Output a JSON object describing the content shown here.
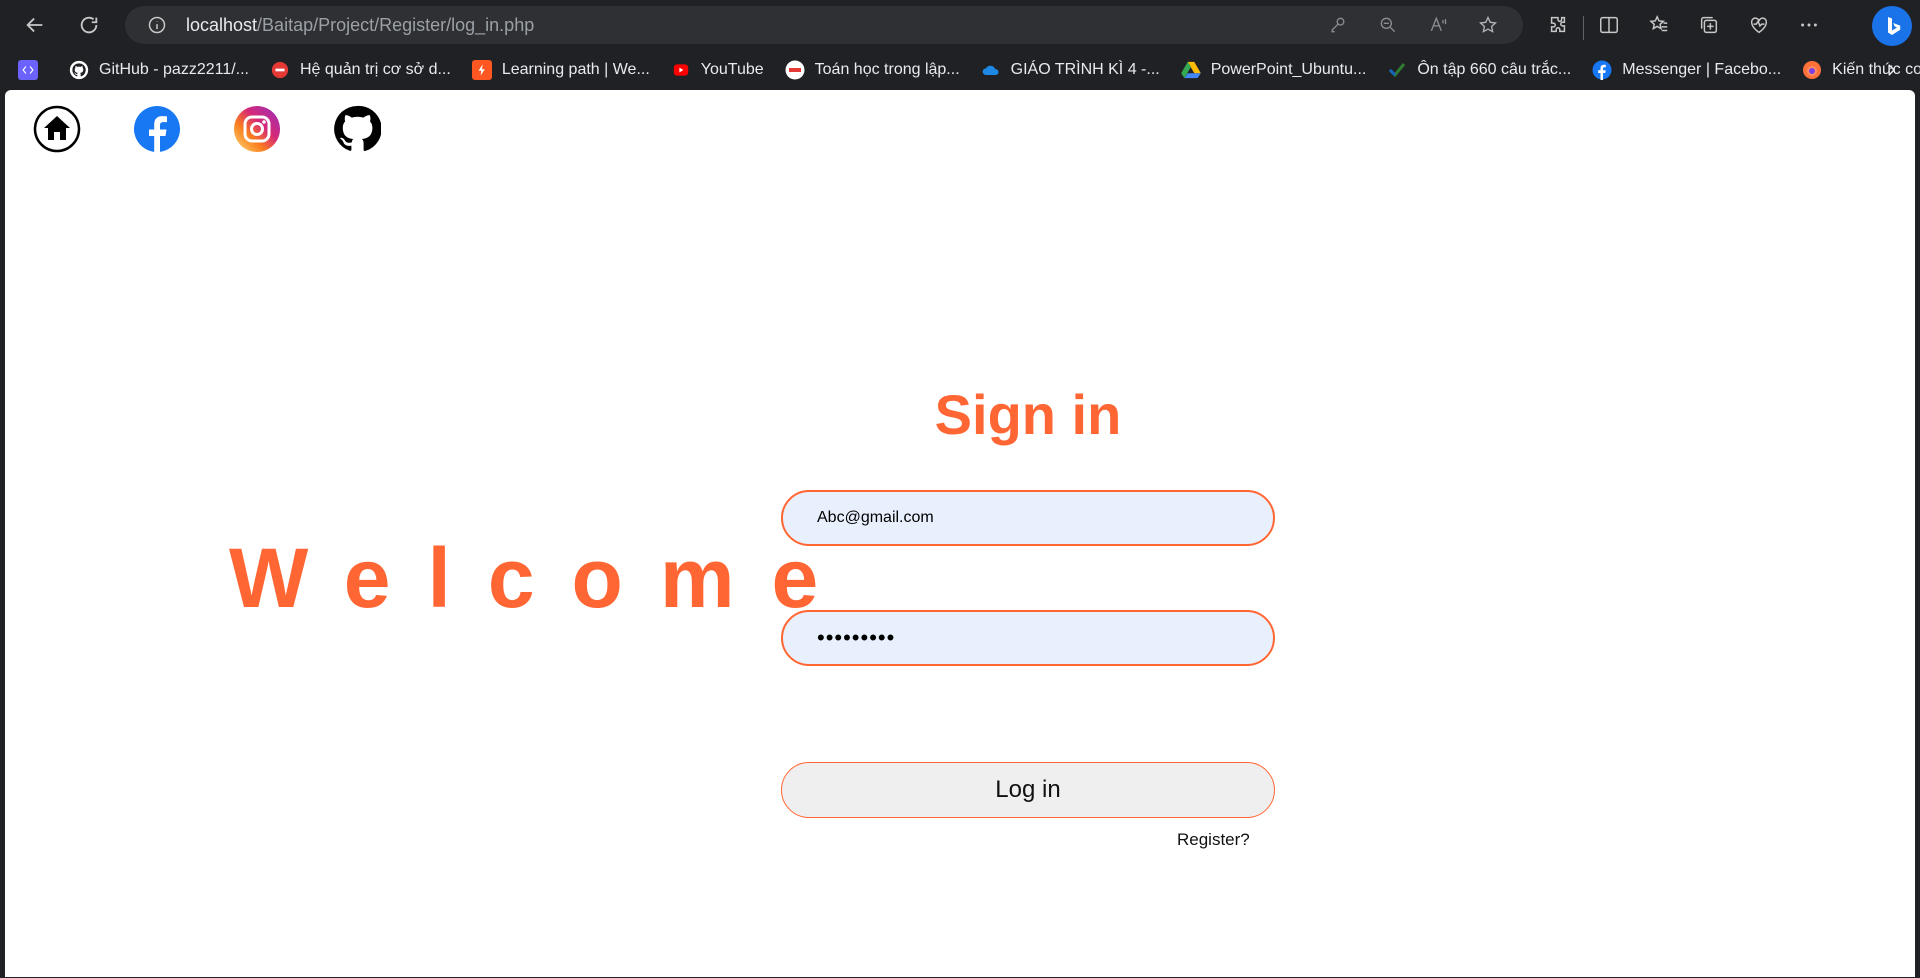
{
  "browser": {
    "url_host": "localhost",
    "url_path": "/Baitap/Project/Register/log_in.php",
    "icons": [
      "back-arrow-icon",
      "refresh-icon",
      "info-icon",
      "key-icon",
      "zoom-out-icon",
      "read-aloud-icon",
      "favorite-star-icon",
      "extensions-icon",
      "split-screen-icon",
      "favorites-icon",
      "collections-icon",
      "browser-essentials-icon",
      "more-icon",
      "copilot-icon"
    ]
  },
  "bookmarks": [
    {
      "label": "",
      "icon": "app-icon",
      "color": "#6c63ff"
    },
    {
      "label": "GitHub - pazz2211/...",
      "icon": "github-icon",
      "color": "#ffffff"
    },
    {
      "label": "Hệ quản trị cơ sở d...",
      "icon": "db-icon",
      "color": "#e53935"
    },
    {
      "label": "Learning path | We...",
      "icon": "learning-icon",
      "color": "#ff5722"
    },
    {
      "label": "YouTube",
      "icon": "youtube-icon",
      "color": "#ff0000"
    },
    {
      "label": "Toán học trong lập...",
      "icon": "math-icon",
      "color": "#ffffff"
    },
    {
      "label": "GIÁO TRÌNH KÌ 4 -...",
      "icon": "onedrive-icon",
      "color": "#1e88e5"
    },
    {
      "label": "PowerPoint_Ubuntu...",
      "icon": "drive-icon",
      "color": "#34a853"
    },
    {
      "label": "Ôn tập 660 câu trắc...",
      "icon": "check-icon",
      "color": "#2e7d32"
    },
    {
      "label": "Messenger | Facebo...",
      "icon": "facebook-icon",
      "color": "#1877f2"
    },
    {
      "label": "Kiến thức cơ bản về...",
      "icon": "firefox-icon",
      "color": "#ff7139"
    }
  ],
  "page": {
    "social": [
      "home-icon",
      "facebook-icon",
      "instagram-icon",
      "github-icon"
    ],
    "welcome": "Welcome",
    "signin_title": "Sign in",
    "email_value": "Abc@gmail.com",
    "password_value": "•••••••••",
    "login_label": "Log in",
    "register_label": "Register?",
    "accent_color": "#ff6633"
  }
}
